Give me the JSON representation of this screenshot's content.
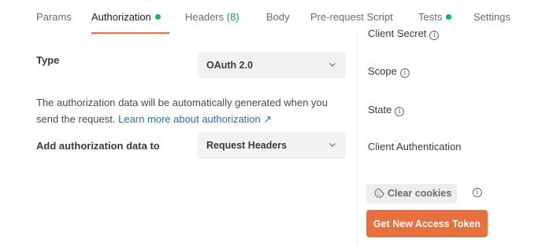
{
  "tabs": [
    {
      "label": "Params"
    },
    {
      "label": "Authorization",
      "active": true,
      "status_dot": true
    },
    {
      "label": "Headers",
      "count": "(8)"
    },
    {
      "label": "Body"
    },
    {
      "label": "Pre-request Script"
    },
    {
      "label": "Tests",
      "status_dot": true
    },
    {
      "label": "Settings"
    }
  ],
  "auth": {
    "type_label": "Type",
    "type_value": "OAuth 2.0",
    "description": "The authorization data will be automatically generated when you send the request.",
    "learn_more": "Learn more about authorization ↗",
    "add_to_label": "Add authorization data to",
    "add_to_value": "Request Headers"
  },
  "oauth": {
    "client_secret_label": "Client Secret",
    "scope_label": "Scope",
    "state_label": "State",
    "client_auth_label": "Client Authentication",
    "clear_cookies_label": "Clear cookies",
    "get_token_label": "Get New Access Token"
  },
  "colors": {
    "accent": "#ff6c37",
    "button": "#e8703f",
    "status_dot": "#0cbb52",
    "link": "#2f6bc9"
  },
  "icons": [
    "chevron-down-icon",
    "info-icon",
    "cookie-icon"
  ]
}
